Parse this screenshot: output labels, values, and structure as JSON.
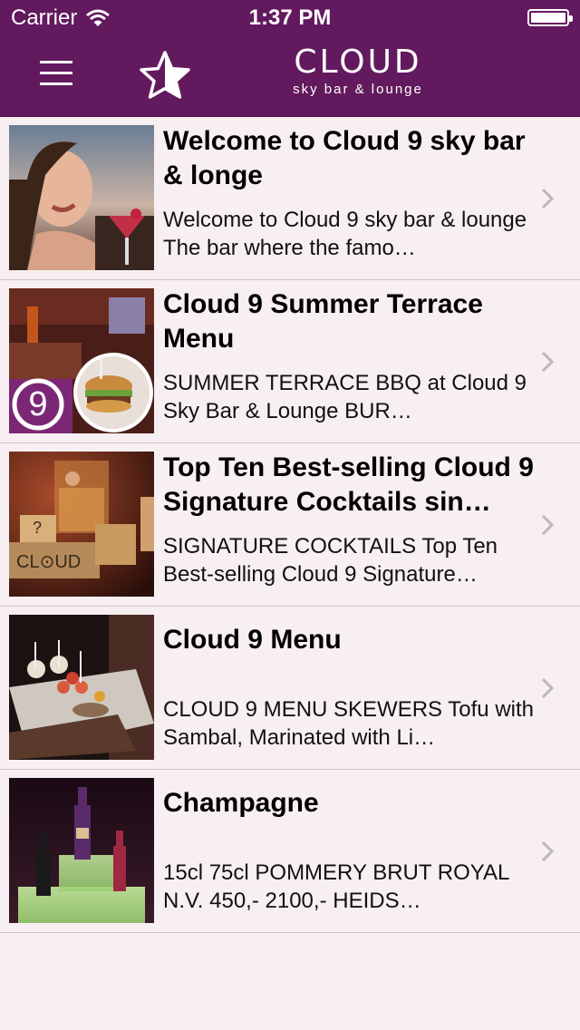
{
  "status_bar": {
    "carrier": "Carrier",
    "time": "1:37 PM"
  },
  "header": {
    "logo_word": "CLOUD",
    "logo_tagline": "sky bar & lounge",
    "menu_icon": "hamburger-icon",
    "favorite_icon": "star-icon"
  },
  "colors": {
    "header_bg": "#63195e",
    "list_bg": "#f7eff2",
    "separator": "#cfc6ca"
  },
  "items": [
    {
      "title": "Welcome to Cloud 9 sky bar & longe",
      "description": "Welcome to Cloud 9 sky bar & lounge The bar where the famo…",
      "image": "woman-with-cocktail"
    },
    {
      "title": "Cloud 9 Summer Terrace Menu",
      "description": "SUMMER TERRACE BBQ at Cloud 9 Sky Bar & Lounge BUR…",
      "image": "terrace-burger"
    },
    {
      "title": "Top Ten Best-selling Cloud 9 Signature Cocktails sin…",
      "description": "SIGNATURE COCKTAILS Top Ten Best-selling Cloud 9 Signature…",
      "image": "signature-cocktails"
    },
    {
      "title": "Cloud 9 Menu",
      "description": "CLOUD 9 MENU SKEWERS Tofu with Sambal, Marinated with Li…",
      "image": "skewers-platter"
    },
    {
      "title": "Champagne",
      "description": "15cl 75cl POMMERY BRUT ROYAL N.V. 450,- 2100,- HEIDS…",
      "image": "champagne-bottles"
    }
  ]
}
